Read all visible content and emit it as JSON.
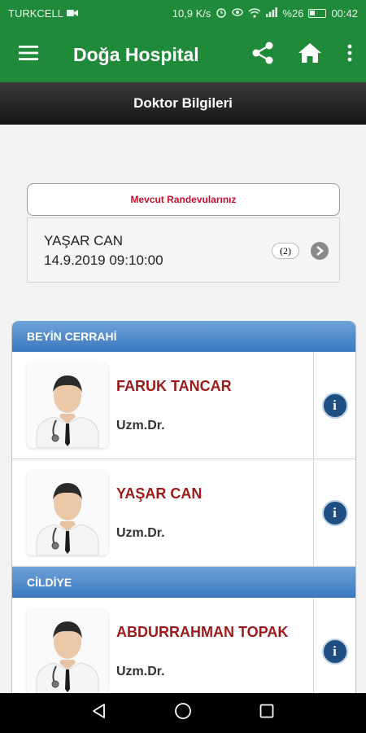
{
  "status_bar": {
    "carrier": "TURKCELL",
    "speed": "10,9 K/s",
    "battery": "%26",
    "time": "00:42"
  },
  "app_bar": {
    "title": "Doğa Hospital",
    "icons": [
      "menu-icon",
      "share-icon",
      "home-icon",
      "more-vert-icon"
    ]
  },
  "sub_header": {
    "title": "Doktor Bilgileri"
  },
  "appointments": {
    "header": "Mevcut Randevularınız",
    "name": "YAŞAR CAN",
    "datetime": "14.9.2019 09:10:00",
    "count": "(2)"
  },
  "departments": [
    {
      "name": "BEYİN CERRAHİ",
      "doctors": [
        {
          "name": "FARUK TANCAR",
          "title": "Uzm.Dr."
        },
        {
          "name": "YAŞAR CAN",
          "title": "Uzm.Dr."
        }
      ]
    },
    {
      "name": "CİLDİYE",
      "doctors": [
        {
          "name": "ABDURRAHMAN TOPAK",
          "title": "Uzm.Dr."
        }
      ]
    }
  ],
  "colors": {
    "app_bar": "#1f8a3a",
    "dept_header": "#3b78be",
    "doctor_name": "#9b1b1b",
    "appointment_header_text": "#c8102e"
  }
}
